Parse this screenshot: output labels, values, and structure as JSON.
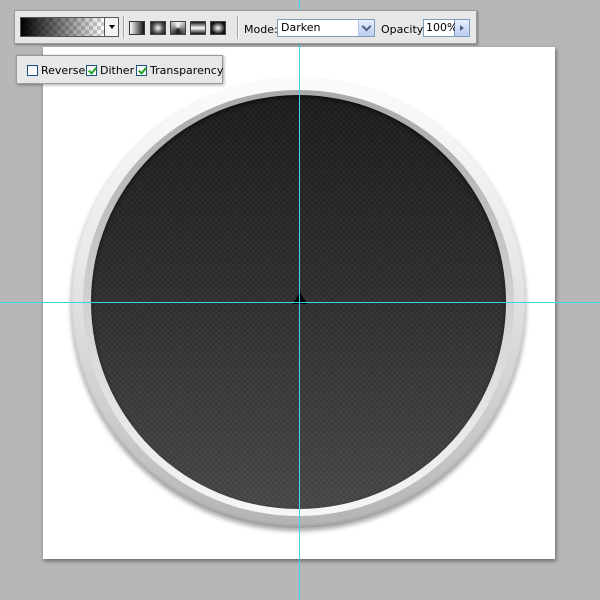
{
  "options_bar": {
    "gradient_picker_icon": "gradient-swatch-black-to-transparent",
    "gradient_types": [
      {
        "name": "linear-gradient-icon"
      },
      {
        "name": "radial-gradient-icon"
      },
      {
        "name": "angle-gradient-icon"
      },
      {
        "name": "reflected-gradient-icon"
      },
      {
        "name": "diamond-gradient-icon"
      }
    ],
    "mode_label": "Mode:",
    "mode_value": "Darken",
    "opacity_label": "Opacity:",
    "opacity_value": "100%"
  },
  "checkbox_panel": {
    "reverse": {
      "label": "Reverse",
      "checked": false
    },
    "dither": {
      "label": "Dither",
      "checked": true
    },
    "transparency": {
      "label": "Transparency",
      "checked": true
    }
  },
  "colors": {
    "guide": "#3ad7ea",
    "workspace": "#b7b7b7",
    "disc_top": "#1b1b1b",
    "disc_bottom": "#474747"
  }
}
